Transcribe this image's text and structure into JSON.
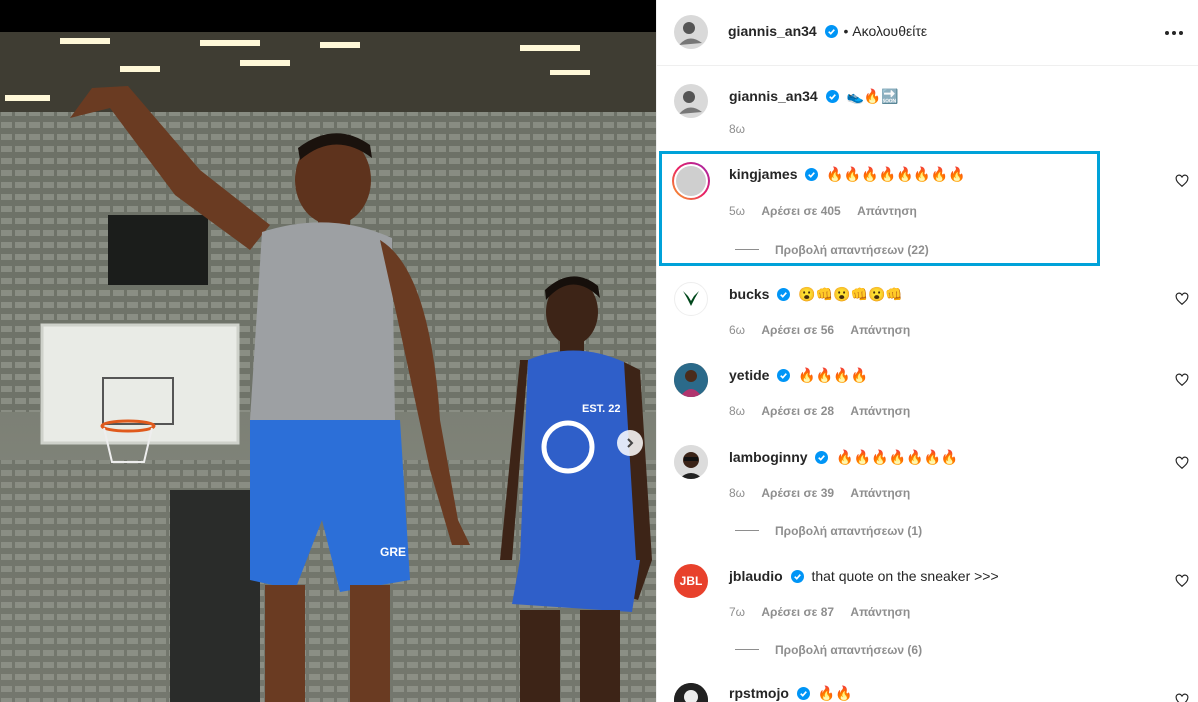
{
  "post": {
    "author": "giannis_an34",
    "follow_status": "• Ακολουθείτε",
    "caption_emoji": "👟🔥🔜",
    "caption_time": "8ω"
  },
  "photo": {
    "jersey_left_text": "GRE",
    "jersey_right_text": "EST. 22"
  },
  "comments": [
    {
      "user": "kingjames",
      "text": "🔥🔥🔥🔥🔥🔥🔥🔥",
      "time": "5ω",
      "likes": "Αρέσει σε 405",
      "reply": "Απάντηση",
      "view_replies": "Προβολή απαντήσεων (22)"
    },
    {
      "user": "bucks",
      "text": "😮👊😮👊😮👊",
      "time": "6ω",
      "likes": "Αρέσει σε 56",
      "reply": "Απάντηση"
    },
    {
      "user": "yetide",
      "text": "🔥🔥🔥🔥",
      "time": "8ω",
      "likes": "Αρέσει σε 28",
      "reply": "Απάντηση"
    },
    {
      "user": "lamboginny",
      "text": "🔥🔥🔥🔥🔥🔥🔥",
      "time": "8ω",
      "likes": "Αρέσει σε 39",
      "reply": "Απάντηση",
      "view_replies": "Προβολή απαντήσεων (1)"
    },
    {
      "user": "jblaudio",
      "text": "that quote on the sneaker >>>",
      "time": "7ω",
      "likes": "Αρέσει σε 87",
      "reply": "Απάντηση",
      "view_replies": "Προβολή απαντήσεων (6)"
    },
    {
      "user": "rpstmojo",
      "text": "🔥🔥"
    }
  ],
  "colors": {
    "accent": "#0095f6",
    "highlight": "#00a2d9",
    "jbl": "#e8412c"
  },
  "icons": {
    "verified": "verified-badge-icon",
    "heart": "heart-icon",
    "more": "more-options-icon",
    "next": "chevron-right-icon"
  }
}
